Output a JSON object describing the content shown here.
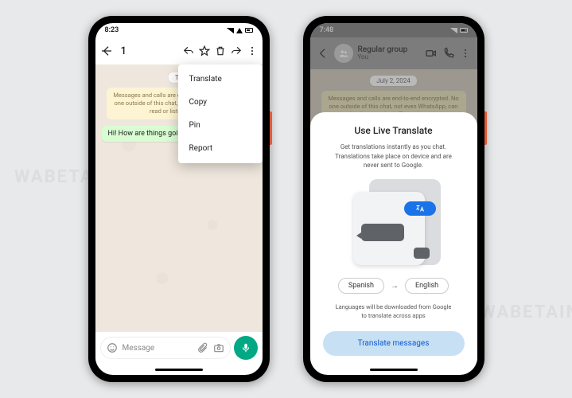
{
  "phone1": {
    "status_time": "8:23",
    "selected_count": "1",
    "enc": "Messages and calls are end-to-end encrypted. No one outside of this chat, not even WhatsApp, can read or listen to them.",
    "date": "To",
    "message_out": "Hi! How are things goin",
    "menu": {
      "translate": "Translate",
      "copy": "Copy",
      "pin": "Pin",
      "report": "Report"
    },
    "input_placeholder": "Message"
  },
  "phone2": {
    "status_time": "7:48",
    "group_name": "Regular group",
    "group_sub": "You",
    "date": "July 2, 2024",
    "enc": "Messages and calls are end-to-end encrypted. No one outside of this chat, not even WhatsApp, can read or listen to them. Tap to learn more.",
    "sheet": {
      "title": "Use Live Translate",
      "desc": "Get translations instantly as you chat. Translations take place on device and are never sent to Google.",
      "lang_from": "Spanish",
      "lang_to": "English",
      "footnote": "Languages will be downloaded from Google to translate across apps",
      "cta": "Translate messages"
    }
  }
}
